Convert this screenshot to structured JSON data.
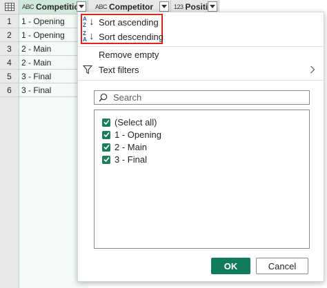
{
  "columns": [
    {
      "type_icon": "ABC",
      "name": "Competition"
    },
    {
      "type_icon": "ABC",
      "name": "Competitor"
    },
    {
      "type_icon": "123",
      "name": "Position"
    }
  ],
  "rows": [
    {
      "num": "1",
      "competition": "1 - Opening"
    },
    {
      "num": "2",
      "competition": "1 - Opening"
    },
    {
      "num": "3",
      "competition": "2 - Main"
    },
    {
      "num": "4",
      "competition": "2 - Main"
    },
    {
      "num": "5",
      "competition": "3 - Final"
    },
    {
      "num": "6",
      "competition": "3 - Final"
    }
  ],
  "menu": {
    "sort_ascending": "Sort ascending",
    "sort_descending": "Sort descending",
    "remove_empty": "Remove empty",
    "text_filters": "Text filters",
    "search_placeholder": "Search",
    "items": [
      "(Select all)",
      "1 - Opening",
      "2 - Main",
      "3 - Final"
    ],
    "ok_label": "OK",
    "cancel_label": "Cancel"
  },
  "colors": {
    "accent": "#107c5b",
    "highlight_border": "#e0201e",
    "checkbox": "#1c7c5c",
    "selected_column": "#cfe8dc"
  },
  "icons": [
    "table-icon",
    "text-type-icon",
    "number-type-icon",
    "dropdown-icon",
    "sort-ascending-icon",
    "sort-descending-icon",
    "funnel-icon",
    "chevron-right-icon",
    "search-icon",
    "check-icon"
  ]
}
